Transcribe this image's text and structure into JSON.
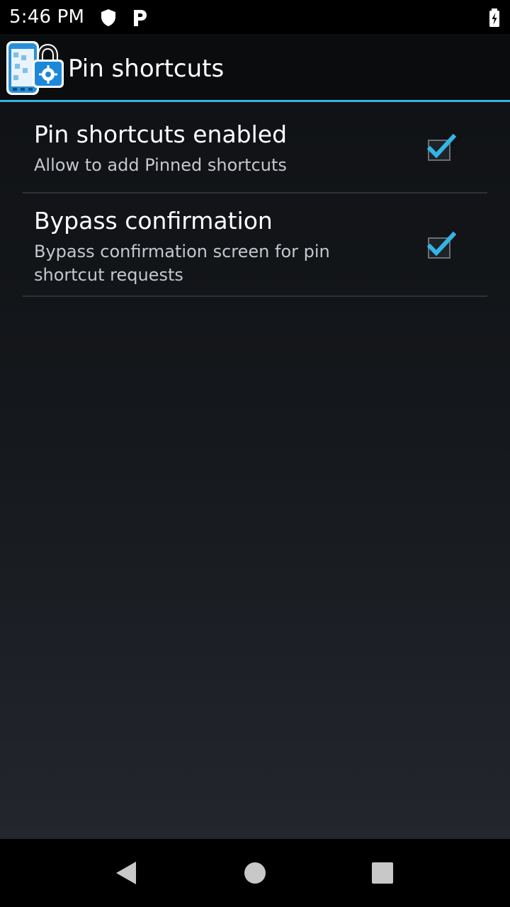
{
  "status_bar": {
    "time": "5:46 PM",
    "icons": [
      "shield-icon",
      "p-icon",
      "battery-charging-icon"
    ]
  },
  "action_bar": {
    "app_icon": "app-phone-lock-icon",
    "title": "Pin shortcuts",
    "accent_color": "#33b5e5"
  },
  "preferences": [
    {
      "title": "Pin shortcuts enabled",
      "summary": "Allow to add Pinned shortcuts",
      "checked": true
    },
    {
      "title": "Bypass confirmation",
      "summary": "Bypass confirmation screen for pin shortcut requests",
      "checked": true
    }
  ],
  "nav_bar": {
    "buttons": [
      "back-icon",
      "home-icon",
      "recents-icon"
    ]
  }
}
